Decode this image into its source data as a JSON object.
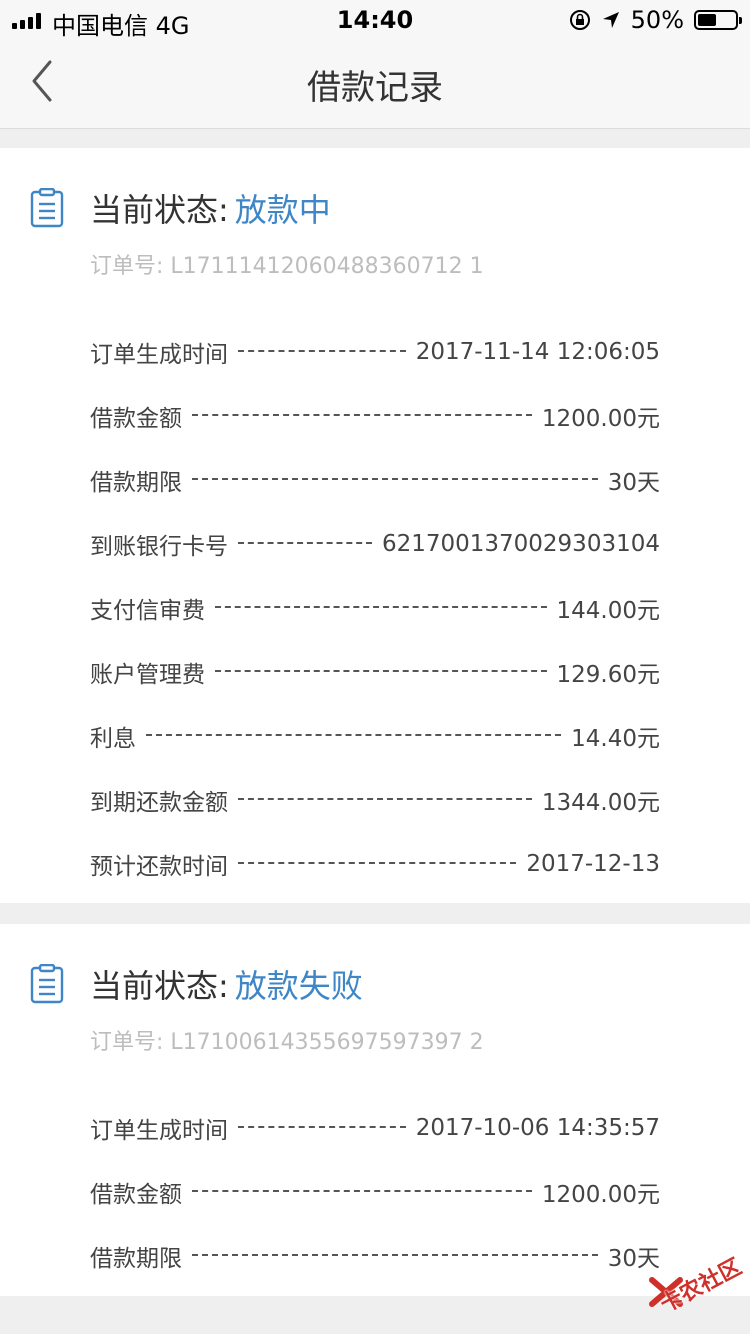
{
  "status_bar": {
    "carrier": "中国电信   4G",
    "time": "14:40",
    "battery": "50%",
    "battery_level": 0.5
  },
  "nav": {
    "title": "借款记录",
    "back_icon": "chevron-left-icon"
  },
  "records": [
    {
      "status_label": "当前状态: ",
      "status_value": "放款中",
      "order_no": "订单号: L17111412060488360712 1",
      "rows": [
        {
          "label": "订单生成时间",
          "value": "2017-11-14 12:06:05"
        },
        {
          "label": "借款金额",
          "value": "1200.00元"
        },
        {
          "label": "借款期限",
          "value": "30天"
        },
        {
          "label": "到账银行卡号",
          "value": "6217001370029303104"
        },
        {
          "label": "支付信审费",
          "value": "144.00元"
        },
        {
          "label": "账户管理费",
          "value": "129.60元"
        },
        {
          "label": "利息",
          "value": "14.40元"
        },
        {
          "label": "到期还款金额",
          "value": "1344.00元"
        },
        {
          "label": "预计还款时间",
          "value": "2017-12-13"
        }
      ]
    },
    {
      "status_label": "当前状态: ",
      "status_value": "放款失败",
      "order_no": "订单号: L17100614355697597397 2",
      "rows": [
        {
          "label": "订单生成时间",
          "value": "2017-10-06 14:35:57"
        },
        {
          "label": "借款金额",
          "value": "1200.00元"
        },
        {
          "label": "借款期限",
          "value": "30天"
        }
      ]
    }
  ],
  "watermark": {
    "text": "卡农社区"
  },
  "colors": {
    "accent": "#3f86c6",
    "background": "#efefef",
    "muted": "#bdbdbd"
  }
}
